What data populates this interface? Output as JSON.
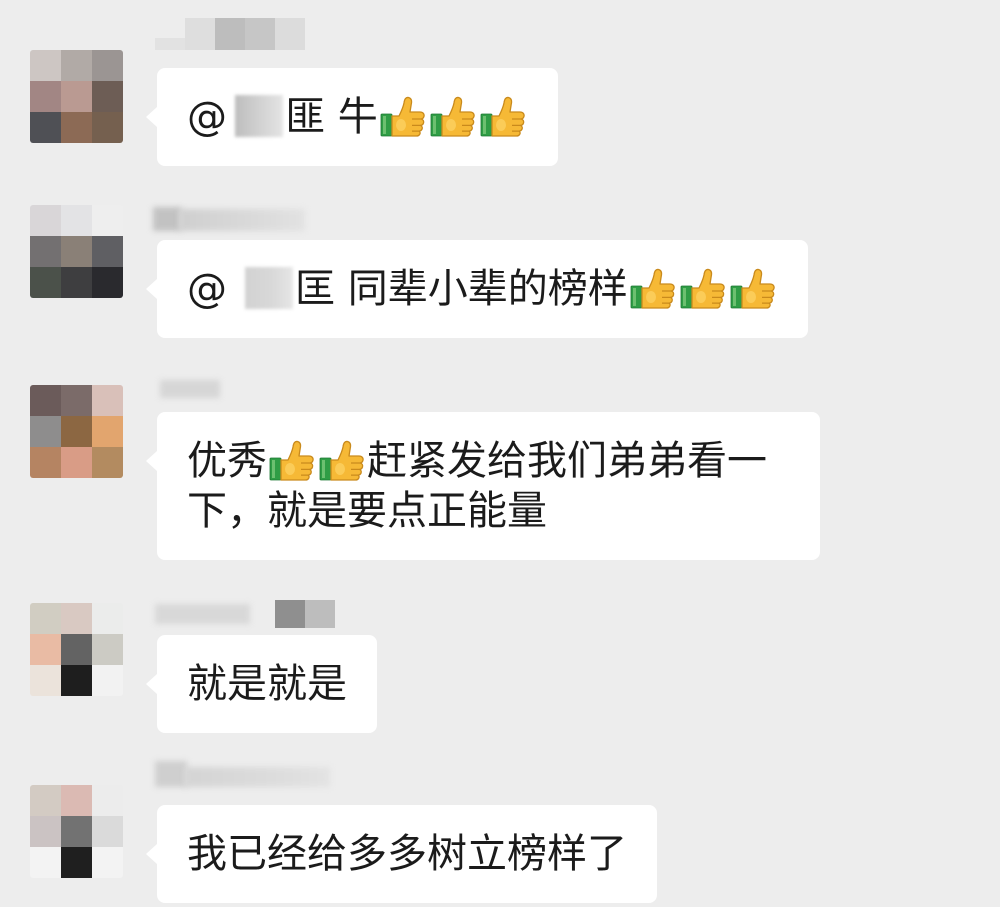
{
  "colors": {
    "background": "#ededed",
    "bubble": "#ffffff",
    "text": "#1b1b1b",
    "thumb_hand": "#f6b936",
    "thumb_outline": "#c98a1c",
    "thumb_cuff": "#2f9d45",
    "redaction": "#c8c8c8"
  },
  "messages": [
    {
      "avatar_pixels": [
        "#cdc6c3",
        "#b1aaa6",
        "#9b9593",
        "#a28684",
        "#ba9a92",
        "#6d5d55",
        "#4f5055",
        "#8c6a55",
        "#75604f"
      ],
      "segments": [
        {
          "text": "@"
        },
        {
          "icon": "redaction-blur"
        },
        {
          "text": "匪 牛"
        },
        {
          "icon": "thumbs-up-icon"
        },
        {
          "icon": "thumbs-up-icon"
        },
        {
          "icon": "thumbs-up-icon"
        }
      ]
    },
    {
      "avatar_pixels": [
        "#d9d6d8",
        "#e3e3e5",
        "#eeeeee",
        "#737071",
        "#8a8077",
        "#5f5f63",
        "#4b514a",
        "#3e3e40",
        "#2a2a2e"
      ],
      "segments": [
        {
          "text": "@"
        },
        {
          "icon": "redaction-blur"
        },
        {
          "text": "匡 同辈小辈的榜样"
        },
        {
          "icon": "thumbs-up-icon"
        },
        {
          "icon": "thumbs-up-icon"
        },
        {
          "icon": "thumbs-up-icon"
        }
      ]
    },
    {
      "avatar_pixels": [
        "#6b5b5a",
        "#7b6b69",
        "#d9c0b9",
        "#8e8d8d",
        "#8c6742",
        "#e2a56e",
        "#b58462",
        "#d99c86",
        "#b38b60"
      ],
      "segments": [
        {
          "text": "优秀"
        },
        {
          "icon": "thumbs-up-icon"
        },
        {
          "icon": "thumbs-up-icon"
        },
        {
          "text": "赶紧发给我们弟弟看一下，就是要点正能量"
        }
      ]
    },
    {
      "avatar_pixels": [
        "#d1cdc2",
        "#d9c9c2",
        "#ebeceb",
        "#e9bba4",
        "#636363",
        "#cccbc4",
        "#ebe3db",
        "#1e1e1e",
        "#f2f2f2"
      ],
      "segments": [
        {
          "text": "就是就是"
        }
      ]
    },
    {
      "avatar_pixels": [
        "#d3cbc3",
        "#dbbab3",
        "#ececec",
        "#cbc3c3",
        "#727272",
        "#dadada",
        "#f3f3f3",
        "#1f1f1f",
        "#f3f3f3"
      ],
      "segments": [
        {
          "text": "我已经给多多树立榜样了"
        }
      ]
    }
  ]
}
